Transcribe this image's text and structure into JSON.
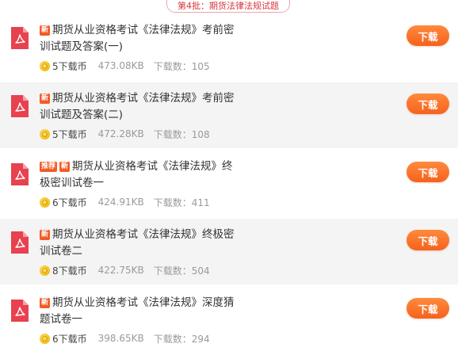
{
  "header": {
    "batch_label": "第4批：期货法律法规试题"
  },
  "labels": {
    "new_badge": "新",
    "recommend_badge": "推荐",
    "download_button": "下载"
  },
  "items": [
    {
      "title": "期货从业资格考试《法律法规》考前密训试题及答案(一)",
      "recommended": false,
      "cost": "5下载币",
      "size": "473.08KB",
      "downloads": "下载数：105"
    },
    {
      "title": "期货从业资格考试《法律法规》考前密训试题及答案(二)",
      "recommended": false,
      "cost": "5下载币",
      "size": "472.28KB",
      "downloads": "下载数：108"
    },
    {
      "title": "期货从业资格考试《法律法规》终极密训试卷一",
      "recommended": true,
      "cost": "6下载币",
      "size": "424.91KB",
      "downloads": "下载数：411"
    },
    {
      "title": "期货从业资格考试《法律法规》终极密训试卷二",
      "recommended": false,
      "cost": "8下载币",
      "size": "422.75KB",
      "downloads": "下载数：504"
    },
    {
      "title": "期货从业资格考试《法律法规》深度猜题试卷一",
      "recommended": false,
      "cost": "6下载币",
      "size": "398.65KB",
      "downloads": "下载数：294"
    }
  ],
  "colors": {
    "accent": "#f5621e",
    "badge": "#f25c27",
    "pdf_icon": "#e8414f",
    "header_text": "#d9363e"
  }
}
